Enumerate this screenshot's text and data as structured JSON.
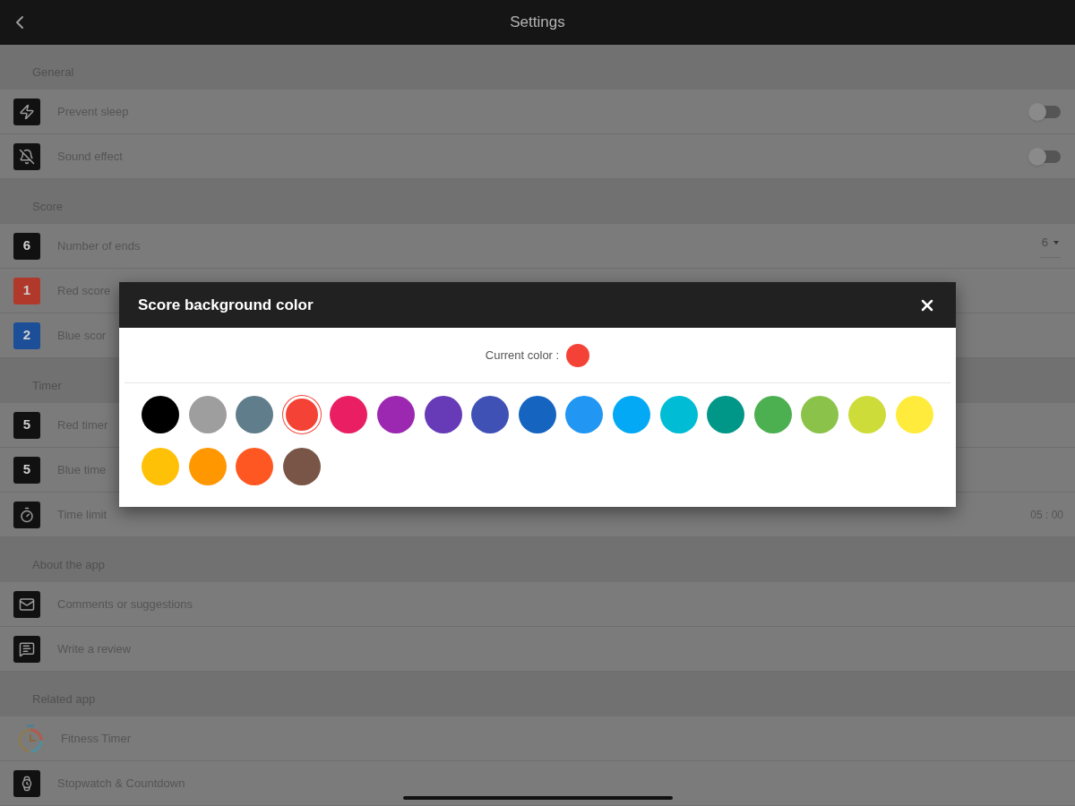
{
  "header": {
    "title": "Settings"
  },
  "sections": [
    {
      "title": "General",
      "items": [
        {
          "kind": "toggle",
          "label": "Prevent sleep",
          "on": false
        },
        {
          "kind": "toggle",
          "label": "Sound effect",
          "on": false
        }
      ]
    },
    {
      "title": "Score",
      "items": [
        {
          "kind": "select",
          "badge": "6",
          "color": "#111111",
          "label": "Number of ends",
          "value": "6"
        },
        {
          "kind": "plain",
          "badge": "1",
          "color": "#b0392b",
          "label": "Red score"
        },
        {
          "kind": "plain",
          "badge": "2",
          "color": "#1c4f97",
          "label": "Blue scor"
        }
      ]
    },
    {
      "title": "Timer",
      "items": [
        {
          "kind": "plain",
          "badge": "5",
          "color": "#111111",
          "label": "Red timer"
        },
        {
          "kind": "plain",
          "badge": "5",
          "color": "#111111",
          "label": "Blue time"
        },
        {
          "kind": "value",
          "label": "Time limit",
          "value": "05 : 00"
        }
      ]
    },
    {
      "title": "About the app",
      "items": [
        {
          "kind": "plain",
          "label": "Comments or suggestions"
        },
        {
          "kind": "plain",
          "label": "Write a review"
        }
      ]
    },
    {
      "title": "Related app",
      "items": [
        {
          "kind": "plain",
          "label": "Fitness Timer"
        },
        {
          "kind": "plain",
          "label": "Stopwatch & Countdown"
        }
      ]
    }
  ],
  "dialog": {
    "title": "Score background color",
    "current_label": "Current color :",
    "current_color": {
      "color": "#f44336"
    },
    "swatches": [
      {
        "color": "#000000",
        "selected": false
      },
      {
        "color": "#9e9e9e",
        "selected": false
      },
      {
        "color": "#607d8b",
        "selected": false
      },
      {
        "color": "#f44336",
        "selected": true
      },
      {
        "color": "#e91e63",
        "selected": false
      },
      {
        "color": "#9c27b0",
        "selected": false
      },
      {
        "color": "#673ab7",
        "selected": false
      },
      {
        "color": "#3f51b5",
        "selected": false
      },
      {
        "color": "#1565c0",
        "selected": false
      },
      {
        "color": "#2196f3",
        "selected": false
      },
      {
        "color": "#03a9f4",
        "selected": false
      },
      {
        "color": "#00bcd4",
        "selected": false
      },
      {
        "color": "#009688",
        "selected": false
      },
      {
        "color": "#4caf50",
        "selected": false
      },
      {
        "color": "#8bc34a",
        "selected": false
      },
      {
        "color": "#cddc39",
        "selected": false
      },
      {
        "color": "#ffeb3b",
        "selected": false
      },
      {
        "color": "#ffc107",
        "selected": false
      },
      {
        "color": "#ff9800",
        "selected": false
      },
      {
        "color": "#ff5722",
        "selected": false
      },
      {
        "color": "#795548",
        "selected": false
      }
    ]
  }
}
